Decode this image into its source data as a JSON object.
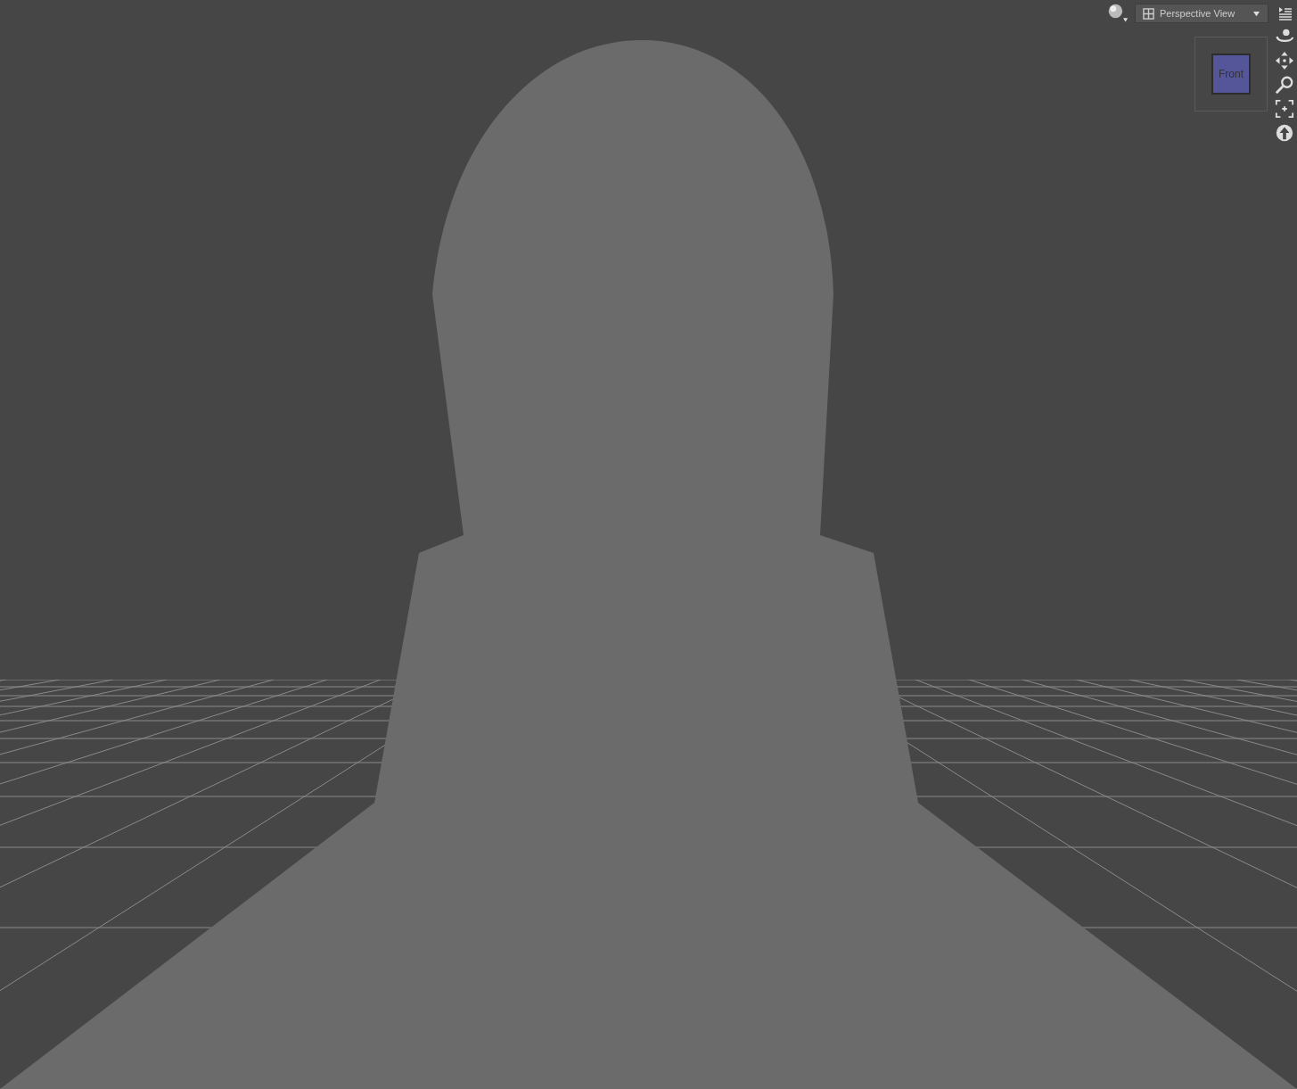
{
  "viewport": {
    "camera_menu": {
      "label": "Perspective View"
    },
    "view_cube": {
      "face": "Front"
    }
  }
}
